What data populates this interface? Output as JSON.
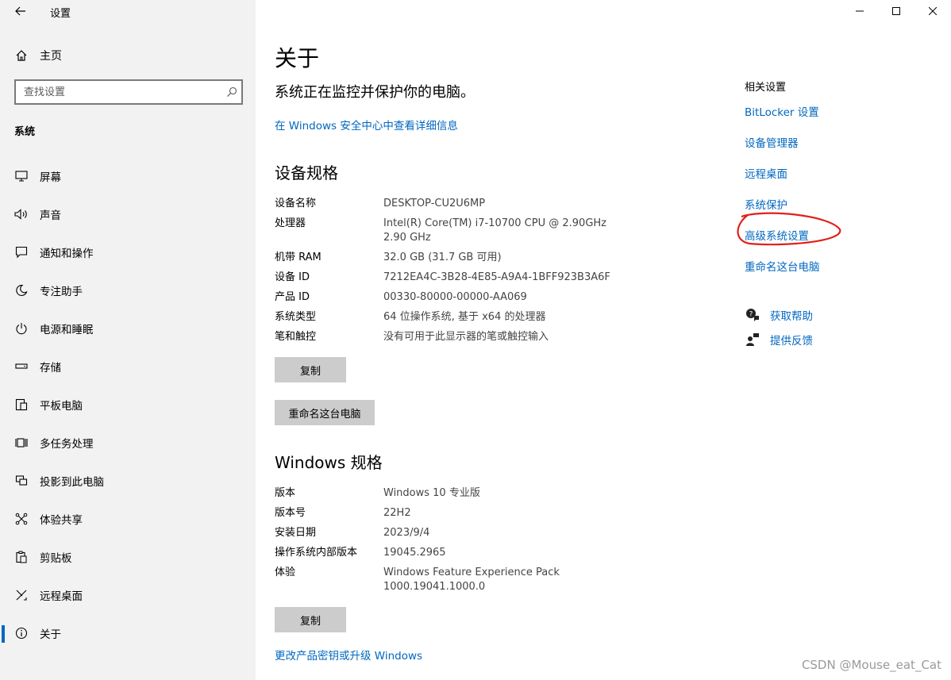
{
  "window": {
    "title": "设置",
    "controls": {
      "minimize": "—",
      "maximize": "☐",
      "close": "✕"
    }
  },
  "sidebar": {
    "home_label": "主页",
    "search": {
      "placeholder": "查找设置",
      "value": ""
    },
    "section_label": "系统",
    "items": [
      {
        "label": "屏幕",
        "icon": "display-icon"
      },
      {
        "label": "声音",
        "icon": "speaker-icon"
      },
      {
        "label": "通知和操作",
        "icon": "notification-icon"
      },
      {
        "label": "专注助手",
        "icon": "moon-icon"
      },
      {
        "label": "电源和睡眠",
        "icon": "power-icon"
      },
      {
        "label": "存储",
        "icon": "storage-icon"
      },
      {
        "label": "平板电脑",
        "icon": "tablet-icon"
      },
      {
        "label": "多任务处理",
        "icon": "multitask-icon"
      },
      {
        "label": "投影到此电脑",
        "icon": "project-icon"
      },
      {
        "label": "体验共享",
        "icon": "share-icon"
      },
      {
        "label": "剪贴板",
        "icon": "clipboard-icon"
      },
      {
        "label": "远程桌面",
        "icon": "remote-icon"
      },
      {
        "label": "关于",
        "icon": "info-icon",
        "active": true
      }
    ]
  },
  "main": {
    "title": "关于",
    "protection_text": "系统正在监控并保护你的电脑。",
    "security_link": "在 Windows 安全中心中查看详细信息",
    "device_specs": {
      "heading": "设备规格",
      "rows": [
        {
          "label": "设备名称",
          "value": "DESKTOP-CU2U6MP"
        },
        {
          "label": "处理器",
          "value": "Intel(R) Core(TM) i7-10700 CPU @ 2.90GHz   2.90 GHz"
        },
        {
          "label": "机带 RAM",
          "value": "32.0 GB (31.7 GB 可用)"
        },
        {
          "label": "设备 ID",
          "value": "7212EA4C-3B28-4E85-A9A4-1BFF923B3A6F"
        },
        {
          "label": "产品 ID",
          "value": "00330-80000-00000-AA069"
        },
        {
          "label": "系统类型",
          "value": "64 位操作系统, 基于 x64 的处理器"
        },
        {
          "label": "笔和触控",
          "value": "没有可用于此显示器的笔或触控输入"
        }
      ],
      "copy_button": "复制",
      "rename_button": "重命名这台电脑"
    },
    "windows_specs": {
      "heading": "Windows 规格",
      "rows": [
        {
          "label": "版本",
          "value": "Windows 10 专业版"
        },
        {
          "label": "版本号",
          "value": "22H2"
        },
        {
          "label": "安装日期",
          "value": "2023/9/4"
        },
        {
          "label": "操作系统内部版本",
          "value": "19045.2965"
        },
        {
          "label": "体验",
          "value": "Windows Feature Experience Pack 1000.19041.1000.0"
        }
      ],
      "copy_button": "复制"
    },
    "upgrade_link": "更改产品密钥或升级 Windows"
  },
  "related": {
    "title": "相关设置",
    "links": [
      "BitLocker 设置",
      "设备管理器",
      "远程桌面",
      "系统保护",
      "高级系统设置",
      "重命名这台电脑"
    ],
    "help": "获取帮助",
    "feedback": "提供反馈"
  },
  "annotation_color": "#e0201b",
  "accent_color": "#0067c0",
  "watermark": "CSDN @Mouse_eat_Cat"
}
